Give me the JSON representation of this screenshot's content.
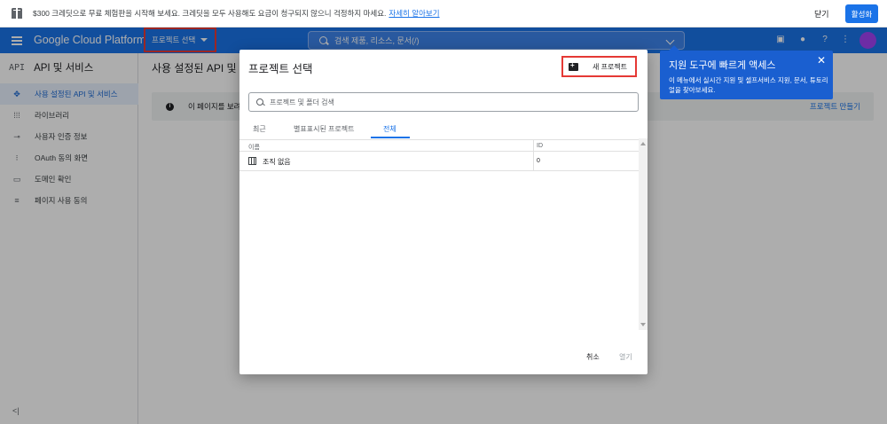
{
  "promo": {
    "text": "$300 크레딧으로 무료 체험판을 시작해 보세요. 크레딧을 모두 사용해도 요금이 청구되지 않으니 걱정하지 마세요.",
    "link": "자세히 알아보기",
    "close": "닫기",
    "activate": "활성화"
  },
  "header": {
    "brand": "Google Cloud Platform",
    "project_select": "프로젝트 선택",
    "search_label": "검색  제품, 리소스, 문서(/)",
    "icons": [
      "cloud-shell-icon",
      "notifications-icon",
      "help-icon",
      "more-vert-icon",
      "avatar"
    ]
  },
  "sidebar": {
    "api_badge": "API",
    "title": "API 및 서비스",
    "items": [
      {
        "icon": "dashboard-icon",
        "label": "사용 설정된 API 및 서비스",
        "active": true
      },
      {
        "icon": "library-icon",
        "label": "라이브러리",
        "active": false
      },
      {
        "icon": "key-icon",
        "label": "사용자 인증 정보",
        "active": false
      },
      {
        "icon": "consent-icon",
        "label": "OAuth 동의 화면",
        "active": false
      },
      {
        "icon": "domain-icon",
        "label": "도메인 확인",
        "active": false
      },
      {
        "icon": "settings-icon",
        "label": "페이지 사용 동의",
        "active": false
      }
    ],
    "collapse": "<|"
  },
  "main": {
    "title": "사용 설정된 API 및 서",
    "info_text": "이 페이지를 보려",
    "create_project": "프로젝트 만들기"
  },
  "dialog": {
    "title": "프로젝트 선택",
    "new_project": "새 프로젝트",
    "search_placeholder": "프로젝트 및 폴더 검색",
    "tabs": [
      {
        "label": "최근",
        "active": false
      },
      {
        "label": "별표표시된 프로젝트",
        "active": false
      },
      {
        "label": "전체",
        "active": true
      }
    ],
    "columns": {
      "name": "이름",
      "id": "ID"
    },
    "rows": [
      {
        "name": "조직 없음",
        "id": "0"
      }
    ],
    "cancel": "취소",
    "open": "열기"
  },
  "tooltip": {
    "title": "지원 도구에 빠르게 액세스",
    "body": "이 메뉴에서 실시간 지원 및 셀프서비스 지원, 문서, 튜토리얼을 찾아보세요.",
    "close": "✕"
  }
}
